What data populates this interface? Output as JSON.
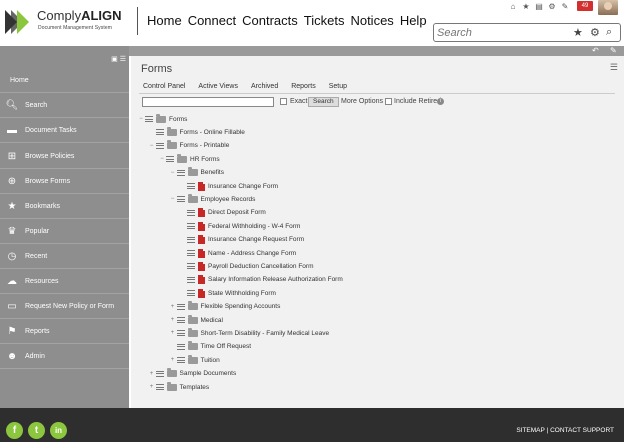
{
  "brand": {
    "name_light": "Comply",
    "name_bold": "ALIGN",
    "tagline": "Document Management System"
  },
  "nav": [
    "Home",
    "Connect",
    "Contracts",
    "Tickets",
    "Notices",
    "Help"
  ],
  "top_bar": {
    "notification_count": "49"
  },
  "search": {
    "placeholder": "Search"
  },
  "sidebar": {
    "items": [
      {
        "label": "Home",
        "icon": "home"
      },
      {
        "label": "Search",
        "icon": "search-icon"
      },
      {
        "label": "Document Tasks",
        "icon": "folder-open-icon"
      },
      {
        "label": "Browse Policies",
        "icon": "folder-plus-icon"
      },
      {
        "label": "Browse Forms",
        "icon": "magnify-icon"
      },
      {
        "label": "Bookmarks",
        "icon": "star-icon"
      },
      {
        "label": "Popular",
        "icon": "trophy-icon"
      },
      {
        "label": "Recent",
        "icon": "clock-icon"
      },
      {
        "label": "Resources",
        "icon": "cloud-icon"
      },
      {
        "label": "Request New Policy or Form",
        "icon": "monitor-icon"
      },
      {
        "label": "Reports",
        "icon": "flag-icon"
      },
      {
        "label": "Admin",
        "icon": "user-badge-icon"
      }
    ]
  },
  "main": {
    "title": "Forms",
    "tabs": [
      "Control Panel",
      "Active Views",
      "Archived",
      "Reports",
      "Setup"
    ],
    "filter": {
      "query": "",
      "exact_label": "Exact",
      "search_button": "Search",
      "more_options": "More Options",
      "include_retired": "Include Retired"
    },
    "tree": [
      {
        "label": "Forms",
        "type": "folder",
        "level": 0,
        "toggle": "−"
      },
      {
        "label": "Forms - Online Fillable",
        "type": "folder",
        "level": 1,
        "toggle": ""
      },
      {
        "label": "Forms - Printable",
        "type": "folder",
        "level": 1,
        "toggle": "−"
      },
      {
        "label": "HR Forms",
        "type": "folder",
        "level": 2,
        "toggle": "−"
      },
      {
        "label": "Benefits",
        "type": "folder",
        "level": 3,
        "toggle": "−"
      },
      {
        "label": "Insurance Change Form",
        "type": "pdf",
        "level": 4,
        "toggle": ""
      },
      {
        "label": "Employee Records",
        "type": "folder",
        "level": 3,
        "toggle": "−"
      },
      {
        "label": "Direct Deposit Form",
        "type": "pdf",
        "level": 4,
        "toggle": ""
      },
      {
        "label": "Federal Withholding - W-4 Form",
        "type": "pdf",
        "level": 4,
        "toggle": ""
      },
      {
        "label": "Insurance Change Request Form",
        "type": "pdf",
        "level": 4,
        "toggle": ""
      },
      {
        "label": "Name - Address Change Form",
        "type": "pdf",
        "level": 4,
        "toggle": ""
      },
      {
        "label": "Payroll Deduction Cancellation Form",
        "type": "pdf",
        "level": 4,
        "toggle": ""
      },
      {
        "label": "Salary Information Release Authorization Form",
        "type": "pdf",
        "level": 4,
        "toggle": ""
      },
      {
        "label": "State Withholding Form",
        "type": "pdf",
        "level": 4,
        "toggle": ""
      },
      {
        "label": "Flexible Spending Accounts",
        "type": "folder",
        "level": 3,
        "toggle": "+"
      },
      {
        "label": "Medical",
        "type": "folder",
        "level": 3,
        "toggle": "+"
      },
      {
        "label": "Short-Term Disability - Family Medical Leave",
        "type": "folder",
        "level": 3,
        "toggle": "+"
      },
      {
        "label": "Time Off Request",
        "type": "folder",
        "level": 3,
        "toggle": ""
      },
      {
        "label": "Tuition",
        "type": "folder",
        "level": 3,
        "toggle": "+"
      },
      {
        "label": "Sample Documents",
        "type": "folder",
        "level": 1,
        "toggle": "+"
      },
      {
        "label": "Templates",
        "type": "folder",
        "level": 1,
        "toggle": "+"
      }
    ]
  },
  "footer": {
    "social": [
      "f",
      "t",
      "in"
    ],
    "sitemap": "SITEMAP",
    "separator": "|",
    "contact": "CONTACT SUPPORT"
  },
  "colors": {
    "sidebar": "#8e8e8e",
    "accent": "#8cc63f",
    "pdf": "#c62828",
    "footer": "#2e2e2e",
    "badge": "#d32f2f"
  }
}
